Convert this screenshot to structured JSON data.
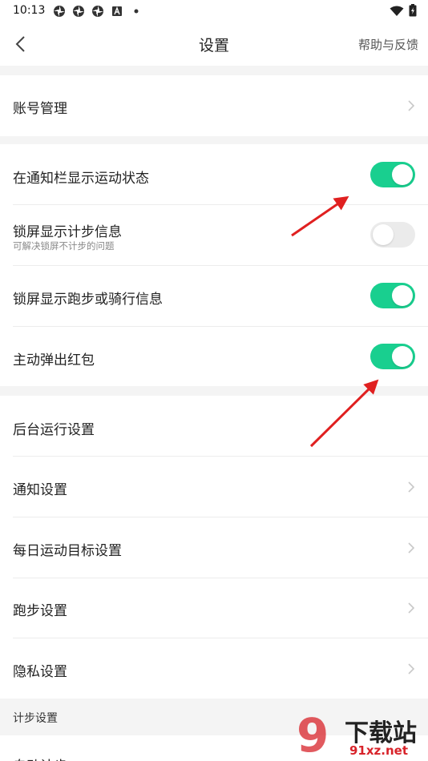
{
  "status_bar": {
    "time": "10:13",
    "left_icons": [
      "pinwheel-icon",
      "pinwheel-icon",
      "pinwheel-icon",
      "a-badge-icon",
      "dot-icon"
    ],
    "right_icons": [
      "wifi-icon",
      "battery-charging-icon"
    ]
  },
  "header": {
    "title": "设置",
    "back_icon": "chevron-left-icon",
    "help_label": "帮助与反馈"
  },
  "rows": {
    "account": {
      "label": "账号管理"
    },
    "notify_bar": {
      "label": "在通知栏显示运动状态",
      "toggle": true
    },
    "lock_steps": {
      "label": "锁屏显示计步信息",
      "sublabel": "可解决锁屏不计步的问题",
      "toggle": false
    },
    "lock_run": {
      "label": "锁屏显示跑步或骑行信息",
      "toggle": true
    },
    "red_packet": {
      "label": "主动弹出红包",
      "toggle": true
    },
    "background": {
      "label": "后台运行设置"
    },
    "notification": {
      "label": "通知设置"
    },
    "daily_goal": {
      "label": "每日运动目标设置"
    },
    "running": {
      "label": "跑步设置"
    },
    "privacy": {
      "label": "隐私设置"
    }
  },
  "section": {
    "step_settings": "计步设置"
  },
  "partial_row": {
    "label": "自动计步"
  },
  "watermark": {
    "text_top": "下载站",
    "text_bottom": "91xz.net",
    "logo": "9"
  },
  "colors": {
    "toggle_on": "#19cf8f",
    "toggle_off": "#ebebeb",
    "background": "#ffffff",
    "gap": "#f4f4f4",
    "annotation_arrow": "#e02020",
    "watermark": "#d8232a"
  }
}
